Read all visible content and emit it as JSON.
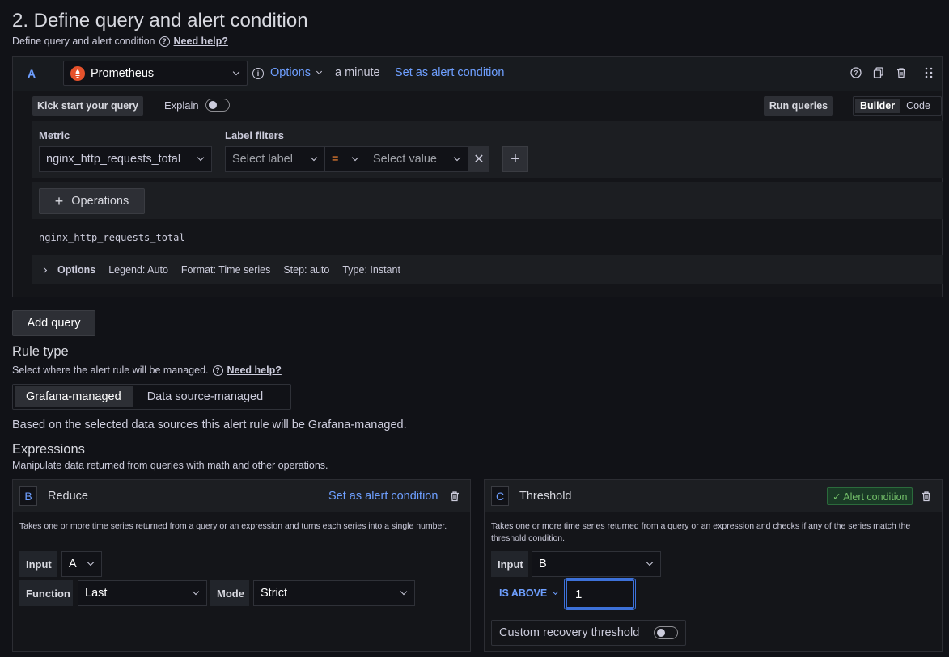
{
  "section": {
    "title": "2. Define query and alert condition",
    "subtitle": "Define query and alert condition",
    "help": "Need help?"
  },
  "query": {
    "letter": "A",
    "datasource": "Prometheus",
    "options_label": "Options",
    "interval": "a minute",
    "set_alert": "Set as alert condition",
    "kick_start": "Kick start your query",
    "explain": "Explain",
    "run_queries": "Run queries",
    "mode_builder": "Builder",
    "mode_code": "Code",
    "metric_label": "Metric",
    "metric_value": "nginx_http_requests_total",
    "label_filters": "Label filters",
    "select_label": "Select label",
    "operator": "=",
    "select_value": "Select value",
    "operations": "Operations",
    "promql": "nginx_http_requests_total",
    "options_title": "Options",
    "legend": "Legend: Auto",
    "format": "Format: Time series",
    "step": "Step: auto",
    "type": "Type: Instant"
  },
  "add_query": "Add query",
  "rule_type": {
    "title": "Rule type",
    "subtitle": "Select where the alert rule will be managed.",
    "help": "Need help?",
    "options": [
      "Grafana-managed",
      "Data source-managed"
    ],
    "selected": "Grafana-managed",
    "note": "Based on the selected data sources this alert rule will be Grafana-managed."
  },
  "expressions": {
    "title": "Expressions",
    "subtitle": "Manipulate data returned from queries with math and other operations.",
    "reduce": {
      "letter": "B",
      "name": "Reduce",
      "set_alert": "Set as alert condition",
      "desc": "Takes one or more time series returned from a query or an expression and turns each series into a single number.",
      "input_label": "Input",
      "input_value": "A",
      "function_label": "Function",
      "function_value": "Last",
      "mode_label": "Mode",
      "mode_value": "Strict"
    },
    "threshold": {
      "letter": "C",
      "name": "Threshold",
      "badge": "✓ Alert condition",
      "desc": "Takes one or more time series returned from a query or an expression and checks if any of the series match the threshold condition.",
      "input_label": "Input",
      "input_value": "B",
      "condition": "IS ABOVE",
      "threshold_value": "1",
      "recovery": "Custom recovery threshold"
    }
  },
  "colors": {
    "accent": "#6e9fff",
    "background": "#111217",
    "prometheus": "#e6522c",
    "success": "#73bf69"
  }
}
